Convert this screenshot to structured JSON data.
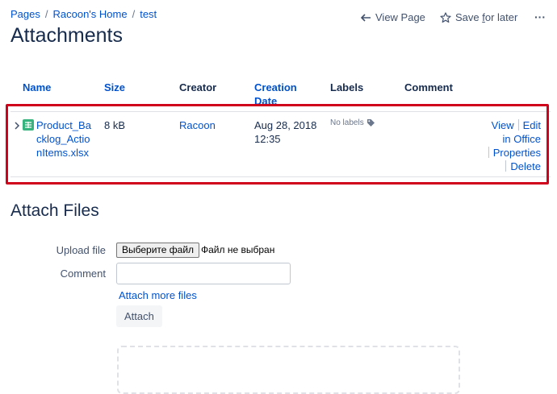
{
  "breadcrumb": {
    "items": [
      "Pages",
      "Racoon's Home",
      "test"
    ],
    "separator": "/"
  },
  "page_actions": {
    "view_page": "View Page",
    "save_for_later_pre": "Save ",
    "save_for_later_u": "f",
    "save_for_later_post": "or later",
    "more": "···"
  },
  "page_title": "Attachments",
  "table": {
    "headers": {
      "name": "Name",
      "size": "Size",
      "creator": "Creator",
      "creation_date_1": "Creation",
      "creation_date_2": "Date",
      "labels": "Labels",
      "comment": "Comment"
    },
    "row": {
      "file_name": "Product_Backlog_ActionItems.xlsx",
      "size": "8 kB",
      "creator": "Racoon",
      "date_1": "Aug 28, 2018",
      "date_2": "12:35",
      "labels": "No labels",
      "actions": {
        "view": "View",
        "edit_1": "Edit",
        "edit_2": "in Office",
        "properties": "Properties",
        "delete": "Delete"
      }
    }
  },
  "attach_section": {
    "title": "Attach Files",
    "upload_label": "Upload file",
    "choose_file": "Выберите файл",
    "no_file": "Файл не выбран",
    "comment_label": "Comment",
    "comment_value": "",
    "attach_more": "Attach more files",
    "attach_button": "Attach"
  },
  "colors": {
    "link": "#0052cc",
    "highlight": "#d0021b",
    "xlsx_icon": "#36b37e"
  },
  "icons": [
    "arrow-left-icon",
    "star-icon",
    "more-icon",
    "chevron-right-icon",
    "spreadsheet-icon",
    "tag-icon"
  ]
}
